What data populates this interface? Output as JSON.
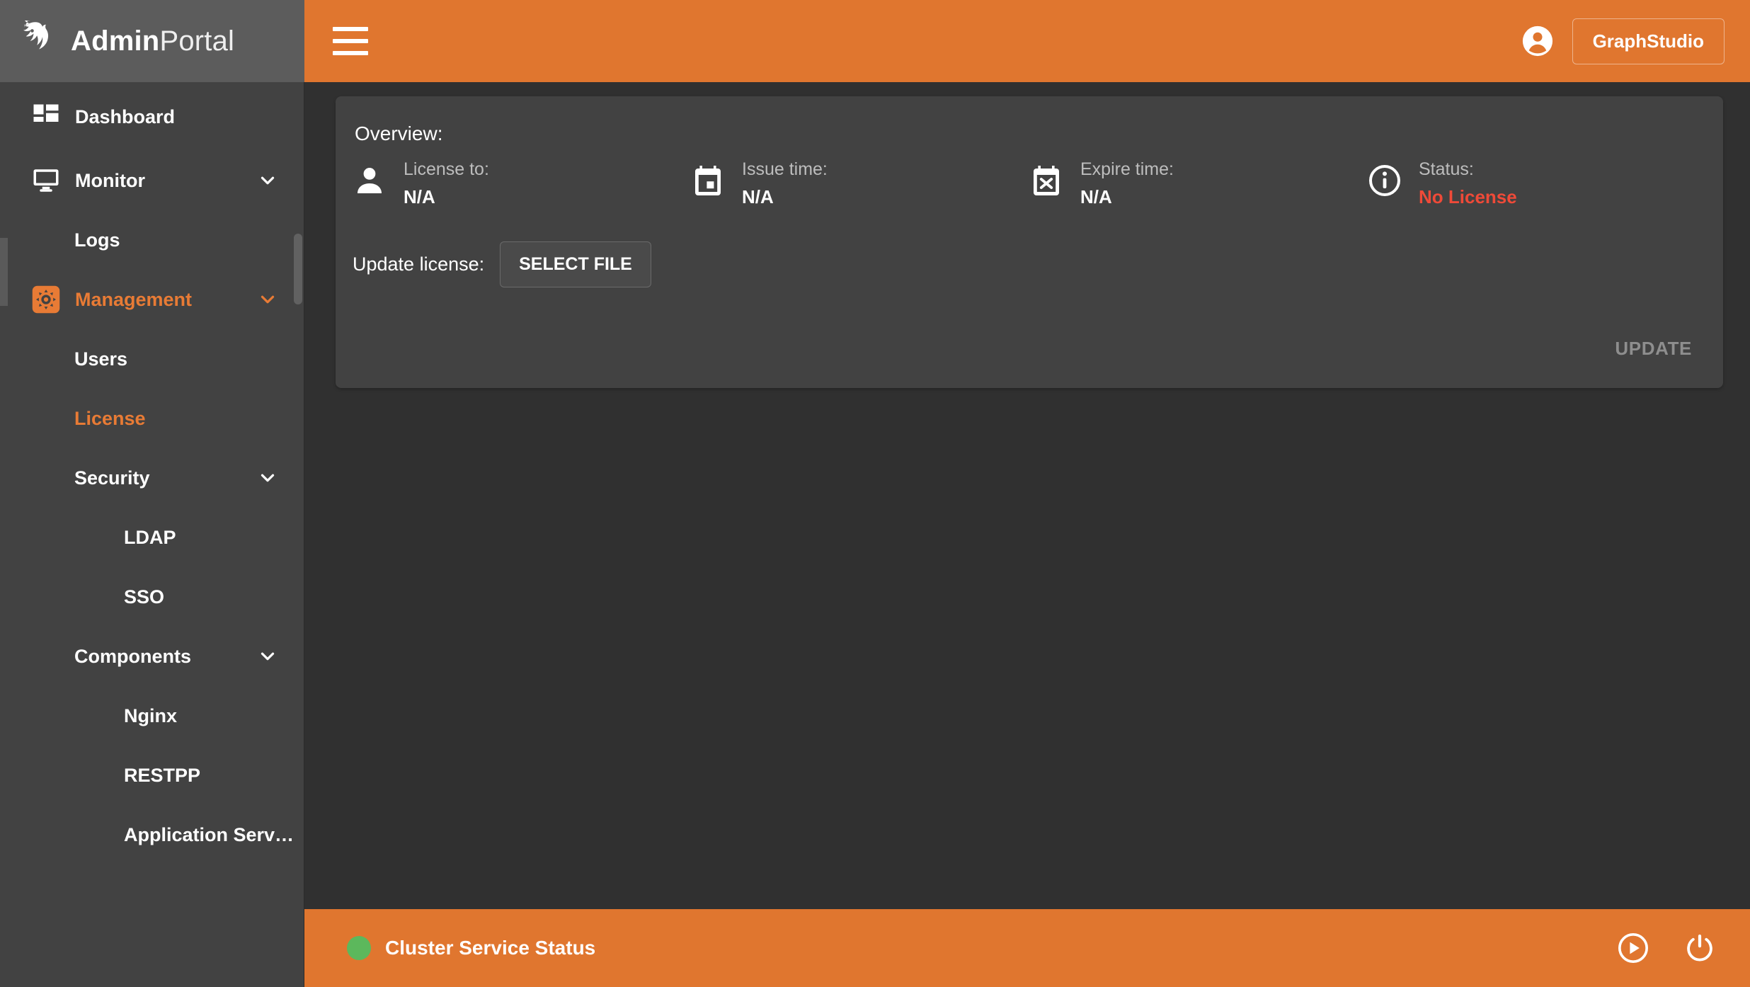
{
  "brand": {
    "name_bold": "Admin",
    "name_light": "Portal",
    "logo_icon": "tiger-head-logo"
  },
  "topbar": {
    "menu_icon": "hamburger-menu-icon",
    "account_icon": "account-circle-icon",
    "studio_button": "GraphStudio"
  },
  "sidebar": {
    "items": [
      {
        "label": "Dashboard",
        "level": 0,
        "icon": "dashboard-icon",
        "active": false,
        "expandable": false
      },
      {
        "label": "Monitor",
        "level": 0,
        "icon": "monitor-icon",
        "active": false,
        "expandable": true
      },
      {
        "label": "Logs",
        "level": 1,
        "icon": "",
        "active": false,
        "expandable": false
      },
      {
        "label": "Management",
        "level": 0,
        "icon": "settings-icon",
        "active": true,
        "expandable": true
      },
      {
        "label": "Users",
        "level": 1,
        "icon": "",
        "active": false,
        "expandable": false
      },
      {
        "label": "License",
        "level": 1,
        "icon": "",
        "active": true,
        "expandable": false
      },
      {
        "label": "Security",
        "level": 1,
        "icon": "",
        "active": false,
        "expandable": true
      },
      {
        "label": "LDAP",
        "level": 2,
        "icon": "",
        "active": false,
        "expandable": false
      },
      {
        "label": "SSO",
        "level": 2,
        "icon": "",
        "active": false,
        "expandable": false
      },
      {
        "label": "Components",
        "level": 1,
        "icon": "",
        "active": false,
        "expandable": true
      },
      {
        "label": "Nginx",
        "level": 2,
        "icon": "",
        "active": false,
        "expandable": false
      },
      {
        "label": "RESTPP",
        "level": 2,
        "icon": "",
        "active": false,
        "expandable": false
      },
      {
        "label": "Application Serv…",
        "level": 2,
        "icon": "",
        "active": false,
        "expandable": false
      }
    ]
  },
  "license_card": {
    "title": "Overview:",
    "fields": [
      {
        "icon": "person-icon",
        "label": "License to:",
        "value": "N/A",
        "danger": false
      },
      {
        "icon": "calendar-today-icon",
        "label": "Issue time:",
        "value": "N/A",
        "danger": false
      },
      {
        "icon": "event-busy-icon",
        "label": "Expire time:",
        "value": "N/A",
        "danger": false
      },
      {
        "icon": "info-circle-icon",
        "label": "Status:",
        "value": "No License",
        "danger": true
      }
    ],
    "update_label": "Update license:",
    "select_file_button": "SELECT FILE",
    "update_button": "UPDATE",
    "update_button_disabled": true
  },
  "footer": {
    "status_label": "Cluster Service Status",
    "status_color": "#5cb85c",
    "start_icon": "play-circle-icon",
    "power_icon": "power-icon"
  },
  "colors": {
    "accent": "#e0762f",
    "sidebar_bg": "#424242",
    "page_bg": "#303030",
    "card_bg": "#424242",
    "danger": "#ef4a38",
    "active_text": "#e87b35"
  }
}
